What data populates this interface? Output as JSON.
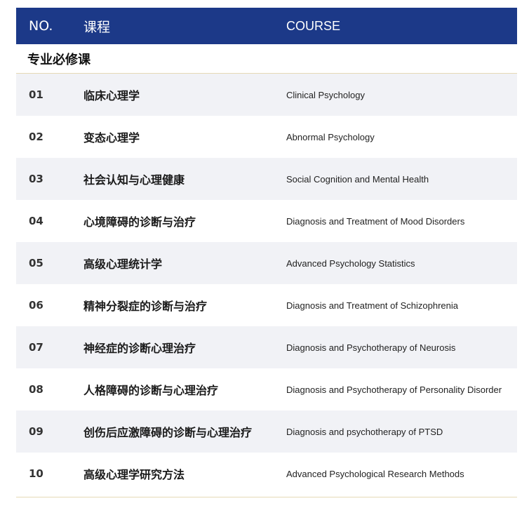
{
  "header": {
    "no": "NO.",
    "cn": "课程",
    "en": "COURSE"
  },
  "section": {
    "title": "专业必修课"
  },
  "courses": [
    {
      "no": "01",
      "cn": "临床心理学",
      "en": "Clinical Psychology"
    },
    {
      "no": "02",
      "cn": "变态心理学",
      "en": "Abnormal Psychology"
    },
    {
      "no": "03",
      "cn": "社会认知与心理健康",
      "en": "Social Cognition and Mental Health"
    },
    {
      "no": "04",
      "cn": "心境障碍的诊断与治疗",
      "en": "Diagnosis and Treatment of Mood Disorders"
    },
    {
      "no": "05",
      "cn": "高级心理统计学",
      "en": "Advanced Psychology Statistics"
    },
    {
      "no": "06",
      "cn": "精神分裂症的诊断与治疗",
      "en": "Diagnosis and Treatment of Schizophrenia"
    },
    {
      "no": "07",
      "cn": "神经症的诊断心理治疗",
      "en": "Diagnosis and Psychotherapy of Neurosis"
    },
    {
      "no": "08",
      "cn": "人格障碍的诊断与心理治疗",
      "en": "Diagnosis and Psychotherapy of Personality Disorder"
    },
    {
      "no": "09",
      "cn": "创伤后应激障碍的诊断与心理治疗",
      "en": "Diagnosis and psychotherapy of PTSD"
    },
    {
      "no": "10",
      "cn": "高级心理学研究方法",
      "en": "Advanced Psychological Research Methods"
    }
  ],
  "colors": {
    "header_bg": "#1c3988",
    "row_shade": "#f1f2f6",
    "rule": "#e5d9b6"
  }
}
